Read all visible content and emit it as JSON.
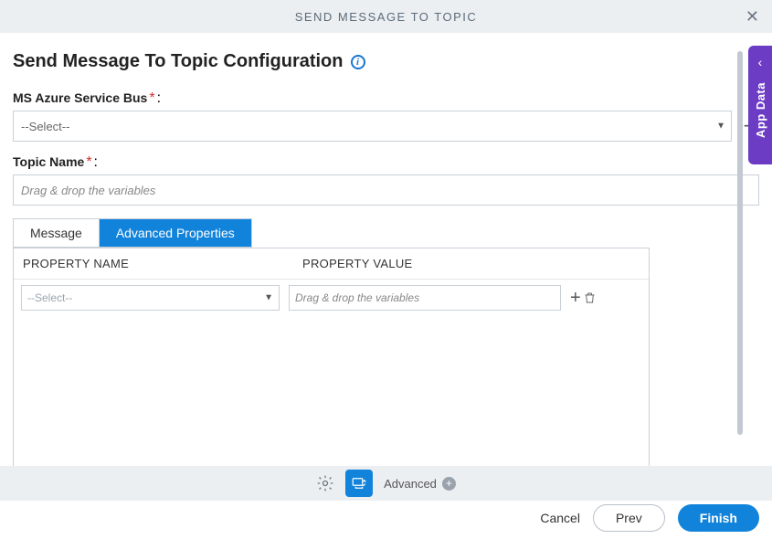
{
  "header": {
    "title": "SEND MESSAGE TO TOPIC"
  },
  "page": {
    "title": "Send Message To Topic Configuration"
  },
  "fields": {
    "azure": {
      "label": "MS Azure Service Bus",
      "value": "--Select--"
    },
    "topic": {
      "label": "Topic Name",
      "placeholder": "Drag & drop the variables"
    }
  },
  "tabs": {
    "message": "Message",
    "advanced": "Advanced Properties"
  },
  "propTable": {
    "header": {
      "name": "PROPERTY NAME",
      "value": "PROPERTY VALUE"
    },
    "row": {
      "select": "--Select--",
      "placeholder": "Drag & drop the variables"
    }
  },
  "footer": {
    "advanced": "Advanced",
    "cancel": "Cancel",
    "prev": "Prev",
    "finish": "Finish"
  },
  "side": {
    "label": "App Data"
  }
}
